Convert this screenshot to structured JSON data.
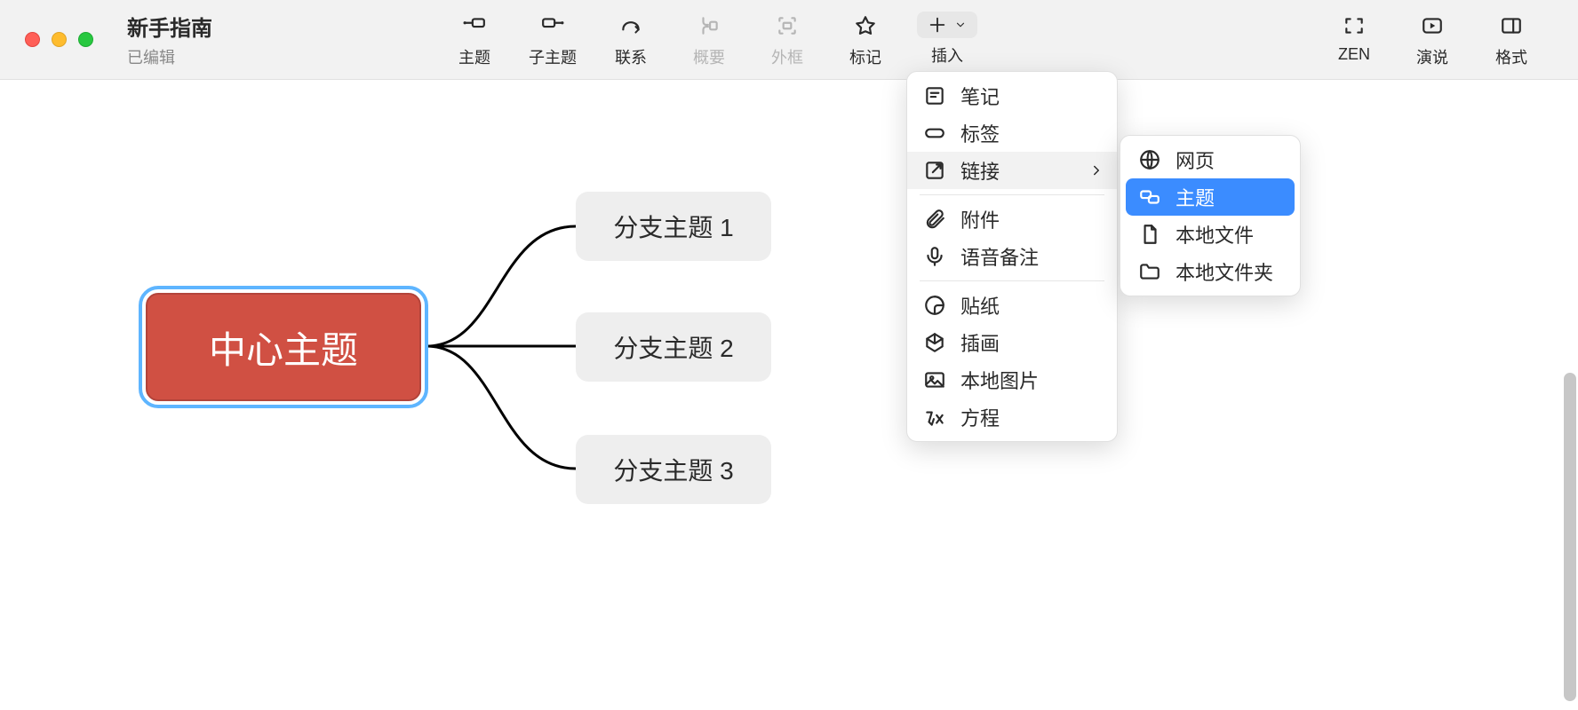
{
  "header": {
    "doc_title": "新手指南",
    "doc_subtitle": "已编辑"
  },
  "toolbar": {
    "topic": "主题",
    "subtopic": "子主题",
    "relationship": "联系",
    "summary": "概要",
    "boundary": "外框",
    "marker": "标记",
    "insert": "插入",
    "zen": "ZEN",
    "pitch": "演说",
    "format": "格式"
  },
  "mindmap": {
    "central": "中心主题",
    "branch1": "分支主题 1",
    "branch2": "分支主题 2",
    "branch3": "分支主题 3"
  },
  "insert_menu": {
    "note": "笔记",
    "label": "标签",
    "link": "链接",
    "attachment": "附件",
    "audio": "语音备注",
    "sticker": "贴纸",
    "illustration": "插画",
    "local_image": "本地图片",
    "equation": "方程"
  },
  "link_submenu": {
    "web": "网页",
    "topic": "主题",
    "local_file": "本地文件",
    "local_folder": "本地文件夹"
  }
}
